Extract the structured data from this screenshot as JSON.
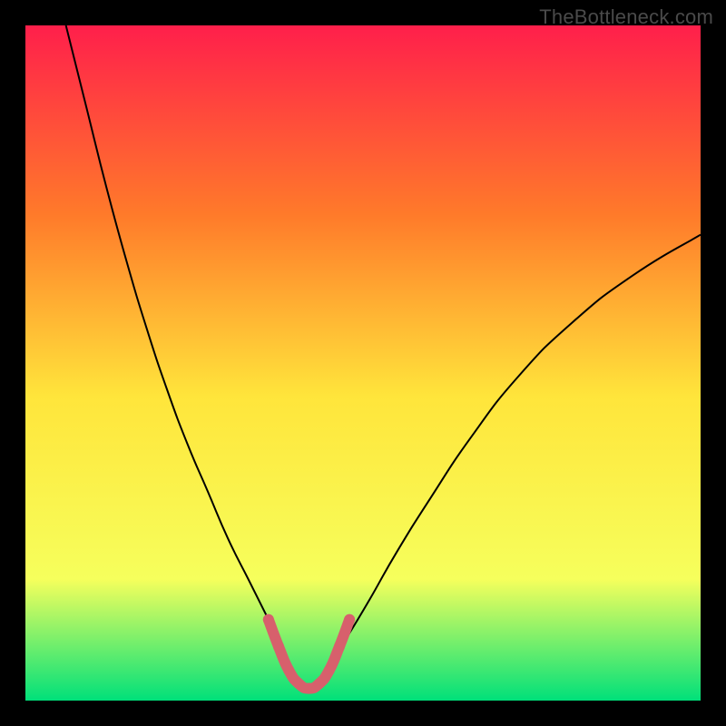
{
  "watermark": "TheBottleneck.com",
  "chart_data": {
    "type": "line",
    "title": "",
    "xlabel": "",
    "ylabel": "",
    "xlim": [
      0,
      100
    ],
    "ylim": [
      0,
      100
    ],
    "grid": false,
    "legend": false,
    "background_gradient": {
      "top_color": "#ff1f4b",
      "upper_mid_color": "#ff7a2a",
      "mid_color": "#ffe53b",
      "lower_mid_color": "#f6ff5c",
      "bottom_color": "#00e07a"
    },
    "series": [
      {
        "name": "curve-left",
        "stroke": "#000000",
        "x": [
          6,
          9,
          12,
          15,
          18,
          21,
          24,
          27,
          30,
          33,
          35,
          37,
          38.5
        ],
        "y": [
          100,
          88,
          76,
          65,
          55,
          46,
          38,
          31,
          24,
          18,
          14,
          10,
          7
        ]
      },
      {
        "name": "curve-right",
        "stroke": "#000000",
        "x": [
          46,
          48,
          51,
          55,
          60,
          66,
          73,
          81,
          90,
          100
        ],
        "y": [
          7,
          10,
          15,
          22,
          30,
          39,
          48,
          56,
          63,
          69
        ]
      },
      {
        "name": "highlight-minimum",
        "stroke": "#d7606c",
        "stroke_width_px": 12,
        "linecap": "round",
        "x": [
          36,
          37.5,
          39,
          40.5,
          42,
          43.5,
          45,
          46.5,
          48
        ],
        "y": [
          12,
          8,
          4.5,
          2.5,
          1.8,
          2.5,
          4.5,
          8,
          12
        ]
      }
    ],
    "annotations": []
  }
}
